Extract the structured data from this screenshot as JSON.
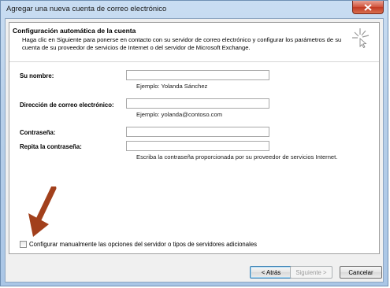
{
  "window": {
    "title": "Agregar una nueva cuenta de correo electrónico"
  },
  "header": {
    "title": "Configuración automática de la cuenta",
    "description": "Haga clic en Siguiente para ponerse en contacto con su servidor de correo electrónico y configurar los parámetros de su cuenta de su proveedor de servicios de Internet o del servidor de Microsoft Exchange."
  },
  "form": {
    "name_label": "Su nombre:",
    "name_value": "",
    "name_hint": "Ejemplo: Yolanda Sánchez",
    "email_label": "Dirección de correo electrónico:",
    "email_value": "",
    "email_hint": "Ejemplo: yolanda@contoso.com",
    "password_label": "Contraseña:",
    "password_value": "",
    "repeat_label": "Repita la contraseña:",
    "repeat_value": "",
    "password_hint": "Escriba la contraseña proporcionada por su proveedor de servicios Internet."
  },
  "manual_config": {
    "label": "Configurar manualmente las opciones del servidor o tipos de servidores adicionales",
    "checked": false
  },
  "buttons": {
    "back": "< Atrás",
    "next": "Siguiente >",
    "cancel": "Cancelar"
  },
  "icons": {
    "close": "close-icon",
    "wizard": "sparkle-cursor-icon",
    "annotation": "arrow-icon"
  },
  "colors": {
    "close_button": "#c23a23",
    "annotation_arrow": "#a2401c",
    "title_bar": "#b7cfe9"
  }
}
